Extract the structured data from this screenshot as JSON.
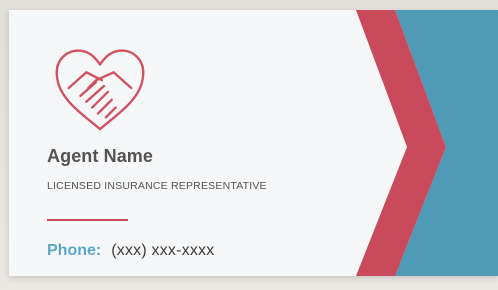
{
  "card": {
    "name": "Agent Name",
    "title": "LICENSED INSURANCE REPRESENTATIVE",
    "phone_label": "Phone:",
    "phone_value": "(xxx) xxx-xxxx"
  },
  "logo": {
    "icon": "heart-handshake-icon"
  },
  "colors": {
    "accent_red": "#c94a5a",
    "accent_blue": "#4f9bb7",
    "card_bg": "#f6f7f8",
    "text_dark": "#535353"
  }
}
